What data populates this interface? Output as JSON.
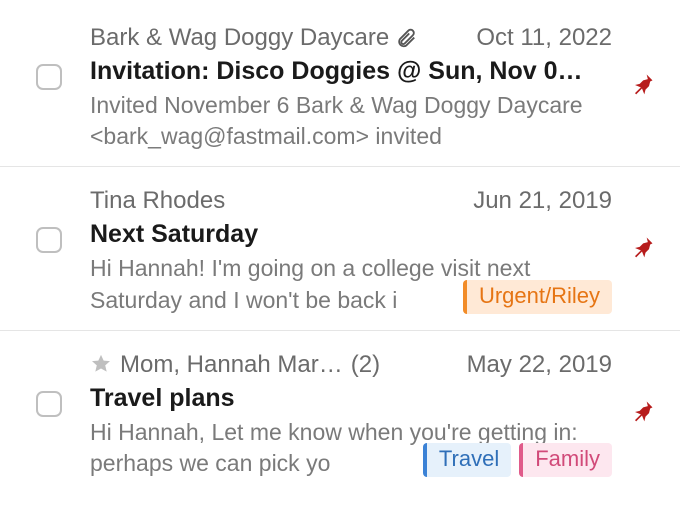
{
  "emails": [
    {
      "from": "Bark & Wag Doggy Daycare",
      "count": "",
      "date": "Oct 11, 2022",
      "has_attachment": true,
      "starred": false,
      "subject": "Invitation: Disco Doggies @ Sun, Nov 0…",
      "preview": "Invited November 6 Bark & Wag Doggy Daycare <bark_wag@fastmail.com> invited",
      "tags": []
    },
    {
      "from": "Tina Rhodes",
      "count": "",
      "date": "Jun 21, 2019",
      "has_attachment": false,
      "starred": false,
      "subject": "Next Saturday",
      "preview": "Hi Hannah! I'm going on a college visit next Saturday and I won't be back i",
      "tags": [
        {
          "label": "Urgent/Riley",
          "bg": "#ffe9d6",
          "border": "#f28c28",
          "color": "#e67514"
        }
      ]
    },
    {
      "from": "Mom, Hannah Mar…",
      "count": "(2)",
      "date": "May 22, 2019",
      "has_attachment": false,
      "starred": true,
      "subject": "Travel plans",
      "preview": "Hi Hannah, Let me know when you're getting in: perhaps we can pick yo",
      "tags": [
        {
          "label": "Travel",
          "bg": "#e6f1fb",
          "border": "#3b82d6",
          "color": "#2f6fb8"
        },
        {
          "label": "Family",
          "bg": "#fde7ef",
          "border": "#e05b8a",
          "color": "#d14a79"
        }
      ]
    }
  ]
}
